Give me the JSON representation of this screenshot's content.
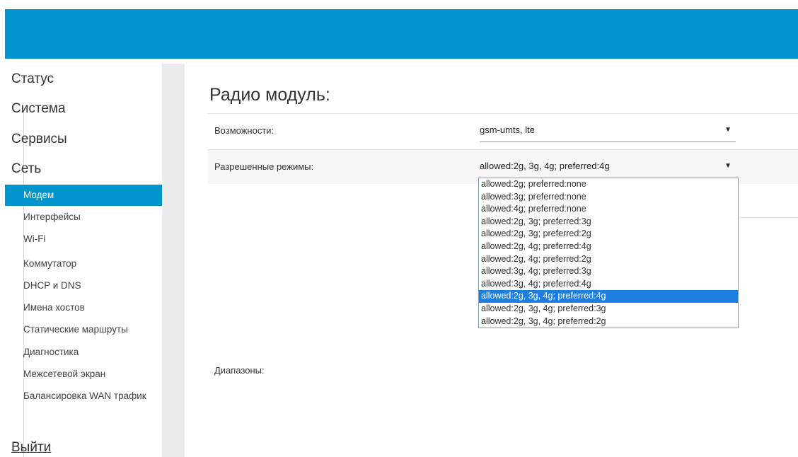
{
  "sidebar": {
    "sections": [
      "Статус",
      "Система",
      "Сервисы",
      "Сеть"
    ],
    "items": [
      "Модем",
      "Интерфейсы",
      "Wi-Fi",
      "Коммутатор",
      "DHCP и DNS",
      "Имена хостов",
      "Статические маршруты",
      "Диагностика",
      "Межсетевой экран",
      "Балансировка WAN трафик"
    ],
    "active_item": "Модем",
    "logout": "Выйти"
  },
  "main": {
    "title": "Радио модуль:",
    "capabilities": {
      "label": "Возможности:",
      "value": "gsm-umts, lte"
    },
    "modes": {
      "label": "Разрешенные режимы:",
      "value": "allowed:2g, 3g, 4g; preferred:4g",
      "options": [
        "allowed:2g; preferred:none",
        "allowed:3g; preferred:none",
        "allowed:4g; preferred:none",
        "allowed:2g, 3g; preferred:3g",
        "allowed:2g, 3g; preferred:2g",
        "allowed:2g, 4g; preferred:4g",
        "allowed:2g, 4g; preferred:2g",
        "allowed:3g, 4g; preferred:3g",
        "allowed:3g, 4g; preferred:4g",
        "allowed:2g, 3g, 4g; preferred:4g",
        "allowed:2g, 3g, 4g; preferred:3g",
        "allowed:2g, 3g, 4g; preferred:2g"
      ],
      "selected_option": "allowed:2g, 3g, 4g; preferred:4g"
    },
    "ranges": {
      "label": "Диапазоны:"
    }
  },
  "colors": {
    "accent": "#0096cd",
    "sidebar_gutter": "#ececec",
    "option_highlight": "#1e7fe0"
  },
  "icons": [
    "dropdown-arrow-icon"
  ]
}
